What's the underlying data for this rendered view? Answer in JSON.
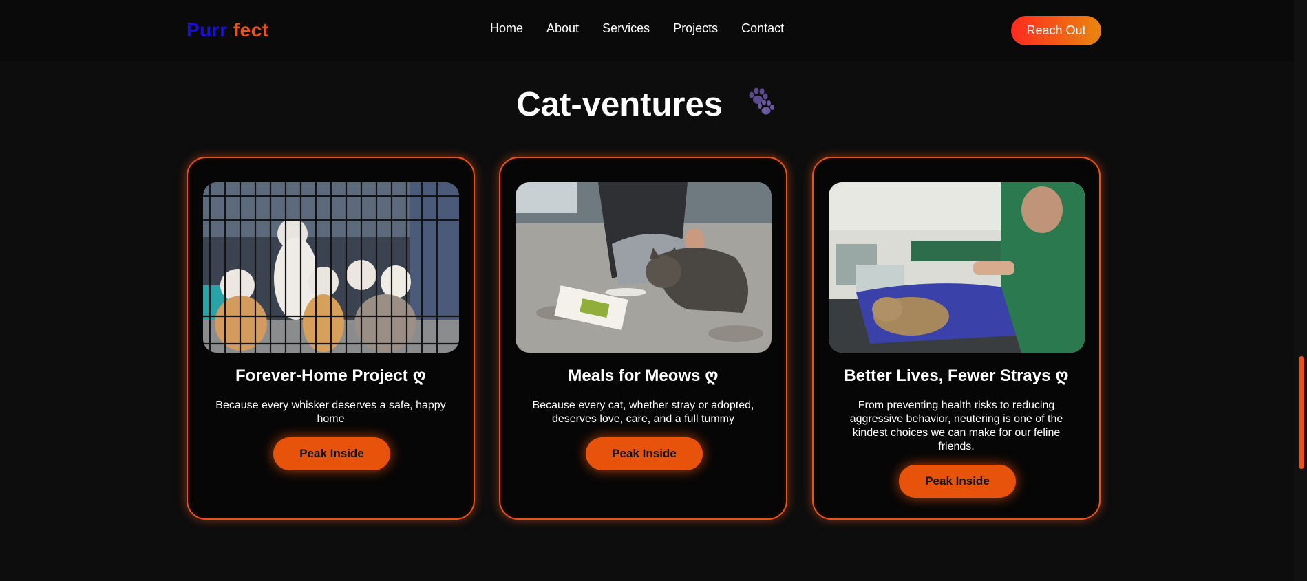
{
  "nav": {
    "logo_part1": "Purr",
    "logo_part2": "fect",
    "links": [
      "Home",
      "About",
      "Services",
      "Projects",
      "Contact"
    ],
    "cta": "Reach Out"
  },
  "section": {
    "title": "Cat-ventures",
    "title_icon": "paw-prints-icon"
  },
  "cards": [
    {
      "title": "Forever-Home Project",
      "title_icon": "heart-glyph-icon",
      "description": "Because every whisker deserves a safe, happy home",
      "button": "Peak Inside",
      "image": "kittens-in-cage-photo"
    },
    {
      "title": "Meals for Meows",
      "title_icon": "heart-glyph-icon",
      "description": "Because every cat, whether stray or adopted, deserves love, care, and a full tummy",
      "button": "Peak Inside",
      "image": "person-feeding-stray-cat-photo"
    },
    {
      "title": "Better Lives, Fewer Strays",
      "title_icon": "heart-glyph-icon",
      "description": "From preventing health risks to reducing aggressive behavior, neutering is one of the kindest choices we can make for our feline friends.",
      "button": "Peak Inside",
      "image": "vet-surgery-cat-photo"
    }
  ],
  "colors": {
    "accent": "#e8531a",
    "logo_blue": "#1a0fd6",
    "background": "#0d0d0d"
  }
}
